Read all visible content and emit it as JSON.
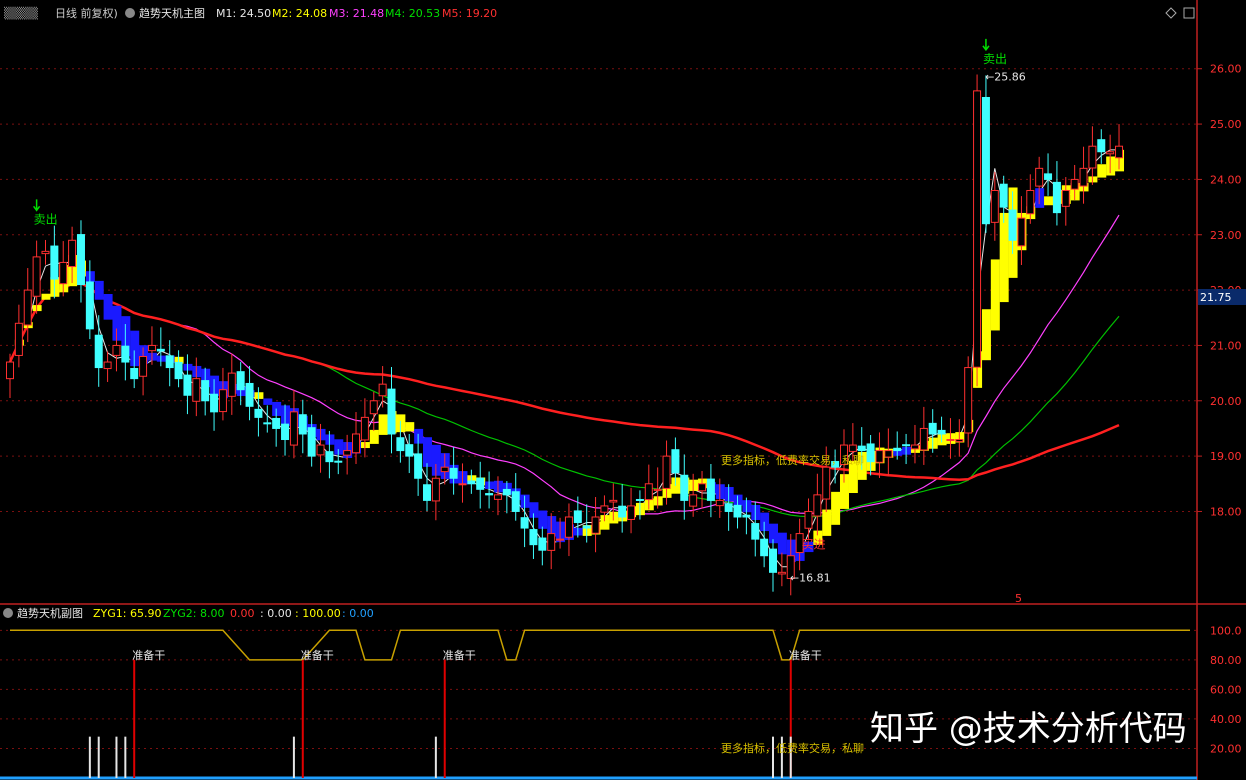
{
  "main_header": {
    "period": "日线 前复权)",
    "indicator": "趋势天机主图",
    "ma": [
      {
        "label": "M1: 24.50",
        "color": "#e6e6e6"
      },
      {
        "label": "M2: 24.08",
        "color": "#ffff00"
      },
      {
        "label": "M3: 21.48",
        "color": "#ff40ff"
      },
      {
        "label": "M4: 20.53",
        "color": "#00e000"
      },
      {
        "label": "M5: 19.20",
        "color": "#ff3030"
      }
    ]
  },
  "sub_header": {
    "indicator": "趋势天机副图",
    "items": [
      {
        "label": "ZYG1: 65.90",
        "color": "#ffff00"
      },
      {
        "label": "ZYG2: 8.00",
        "color": "#00e000"
      },
      {
        "label": "0.00",
        "color": "#ff3030"
      },
      {
        "label": ": 0.00",
        "color": "#e6e6e6"
      },
      {
        "label": ": 100.00",
        "color": "#ffff00"
      },
      {
        "label": ": 0.00",
        "color": "#20a0ff"
      }
    ]
  },
  "annotations": {
    "sell": "卖出",
    "buy": "买进",
    "high": "25.86",
    "low": "16.81",
    "watermark_main": "更多指标，低费率交易，私聊",
    "watermark_sub": "更多指标，低费率交易，私聊",
    "prepare": "准备干",
    "marker5": "5",
    "zhihu": "知乎 @技术分析代码"
  },
  "current_price": "21.75",
  "colors": {
    "up": "#ff3030",
    "down": "#40ffff",
    "grid": "#7a1010",
    "axis": "#c02020",
    "band_up": "#ffff00",
    "band_down": "#1a1aff",
    "zyg1": "#c8a000",
    "zyg2": "#00e000",
    "red_signal": "#e00000"
  },
  "chart_data": {
    "type": "candlestick",
    "main_y_ticks": [
      "26.00",
      "25.00",
      "24.00",
      "23.00",
      "22.00",
      "21.00",
      "20.00",
      "19.00",
      "18.00"
    ],
    "main_ylim": [
      16.4,
      26.7
    ],
    "sub_y_ticks": [
      "100.0",
      "80.00",
      "60.00",
      "40.00",
      "20.00"
    ],
    "sub_ylim": [
      0,
      107
    ],
    "n_bars": 134,
    "high_label": {
      "bar": 109,
      "value": 25.86
    },
    "low_label": {
      "bar": 87,
      "value": 16.81
    },
    "sell_signals": [
      3,
      110
    ],
    "buy_signals": [
      89
    ],
    "prepare_signals": [
      14,
      33,
      49,
      88
    ],
    "white_bars": [
      9,
      10,
      12,
      13,
      32,
      48,
      86,
      87,
      88
    ],
    "closes": [
      20.7,
      21.4,
      22.0,
      22.6,
      22.7,
      22.2,
      22.5,
      22.9,
      22.1,
      21.3,
      20.6,
      20.7,
      21.0,
      20.7,
      20.4,
      20.8,
      21.0,
      20.9,
      20.6,
      20.4,
      20.1,
      20.4,
      20.0,
      19.8,
      20.2,
      20.5,
      20.2,
      19.9,
      19.7,
      19.6,
      19.5,
      19.3,
      19.8,
      19.4,
      19.0,
      19.2,
      18.9,
      18.9,
      19.1,
      19.4,
      19.7,
      20.0,
      20.3,
      19.4,
      19.1,
      19.0,
      18.6,
      18.2,
      18.6,
      18.8,
      18.6,
      18.5,
      18.5,
      18.4,
      18.3,
      18.3,
      18.3,
      18.0,
      17.7,
      17.4,
      17.3,
      17.6,
      17.5,
      17.9,
      17.8,
      17.7,
      17.9,
      18.1,
      18.2,
      17.9,
      18.1,
      18.2,
      18.5,
      18.4,
      19.0,
      18.7,
      18.2,
      18.3,
      18.5,
      18.2,
      18.2,
      18.0,
      17.9,
      17.9,
      17.5,
      17.2,
      16.9,
      16.9,
      17.2,
      17.6,
      18.0,
      18.3,
      18.8,
      18.8,
      19.2,
      19.2,
      19.1,
      18.9,
      19.1,
      19.1,
      19.1,
      19.2,
      19.2,
      19.5,
      19.4,
      19.4,
      19.3,
      19.3,
      20.6,
      25.6,
      23.2,
      23.8,
      23.5,
      22.9,
      23.3,
      23.8,
      24.2,
      24.0,
      23.4,
      23.8,
      24.0,
      24.2,
      24.6,
      24.5,
      24.5,
      24.6
    ]
  }
}
